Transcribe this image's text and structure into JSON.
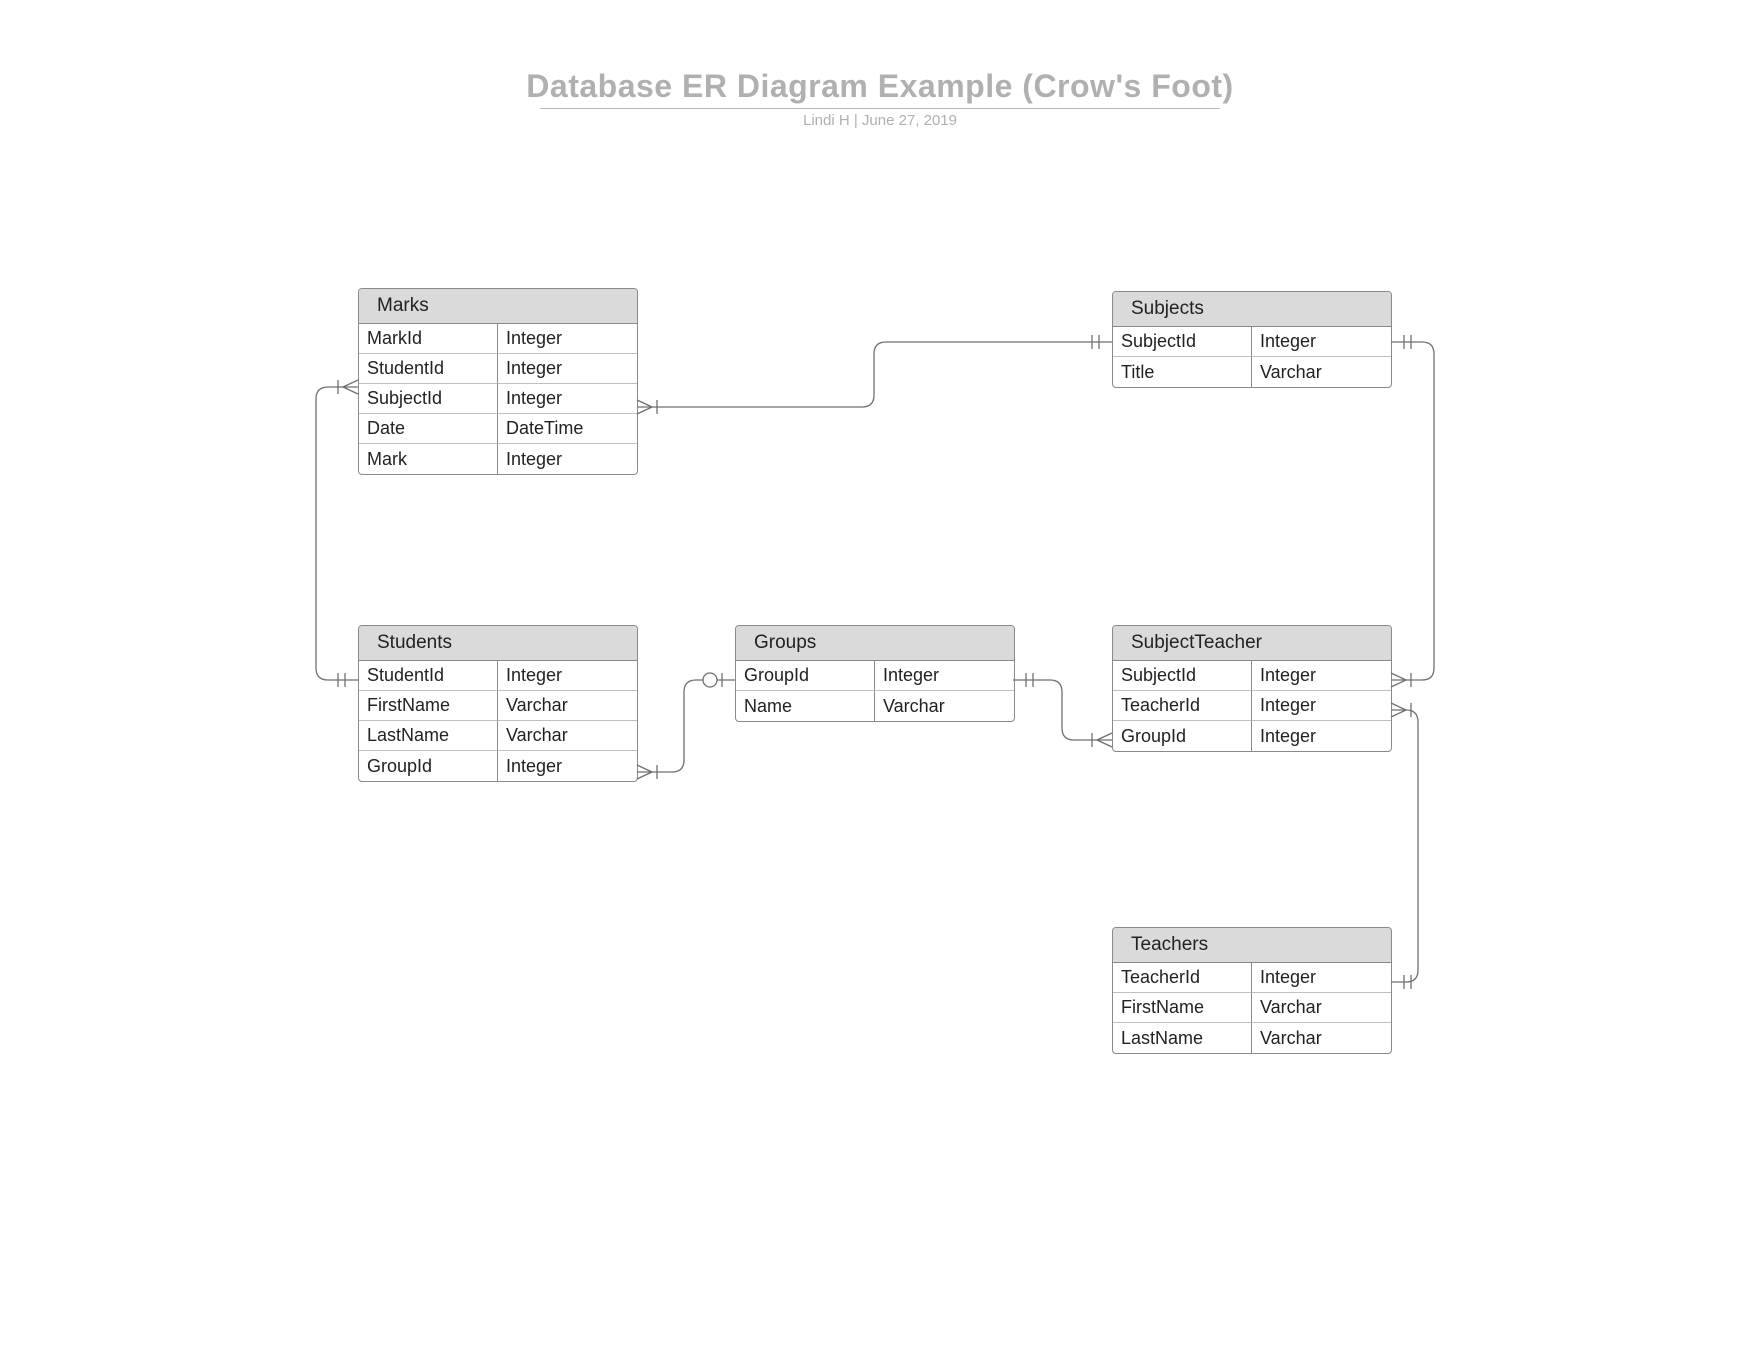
{
  "title": "Database ER Diagram Example (Crow's Foot)",
  "subtitle": "Lindi H  |  June 27, 2019",
  "entities": {
    "marks": {
      "name": "Marks",
      "fields": [
        {
          "name": "MarkId",
          "type": "Integer"
        },
        {
          "name": "StudentId",
          "type": "Integer"
        },
        {
          "name": "SubjectId",
          "type": "Integer"
        },
        {
          "name": "Date",
          "type": "DateTime"
        },
        {
          "name": "Mark",
          "type": "Integer"
        }
      ]
    },
    "subjects": {
      "name": "Subjects",
      "fields": [
        {
          "name": "SubjectId",
          "type": "Integer"
        },
        {
          "name": "Title",
          "type": "Varchar"
        }
      ]
    },
    "students": {
      "name": "Students",
      "fields": [
        {
          "name": "StudentId",
          "type": "Integer"
        },
        {
          "name": "FirstName",
          "type": "Varchar"
        },
        {
          "name": "LastName",
          "type": "Varchar"
        },
        {
          "name": "GroupId",
          "type": "Integer"
        }
      ]
    },
    "groups": {
      "name": "Groups",
      "fields": [
        {
          "name": "GroupId",
          "type": "Integer"
        },
        {
          "name": "Name",
          "type": "Varchar"
        }
      ]
    },
    "subjectteacher": {
      "name": "SubjectTeacher",
      "fields": [
        {
          "name": "SubjectId",
          "type": "Integer"
        },
        {
          "name": "TeacherId",
          "type": "Integer"
        },
        {
          "name": "GroupId",
          "type": "Integer"
        }
      ]
    },
    "teachers": {
      "name": "Teachers",
      "fields": [
        {
          "name": "TeacherId",
          "type": "Integer"
        },
        {
          "name": "FirstName",
          "type": "Varchar"
        },
        {
          "name": "LastName",
          "type": "Varchar"
        }
      ]
    }
  },
  "relationships": [
    {
      "from": "Marks",
      "to": "Students",
      "fromCard": "many",
      "toCard": "one"
    },
    {
      "from": "Marks",
      "to": "Subjects",
      "fromCard": "many",
      "toCard": "one"
    },
    {
      "from": "Students",
      "to": "Groups",
      "fromCard": "many",
      "toCard": "zero-or-one"
    },
    {
      "from": "Groups",
      "to": "SubjectTeacher",
      "fromCard": "one",
      "toCard": "many"
    },
    {
      "from": "Subjects",
      "to": "SubjectTeacher",
      "fromCard": "one",
      "toCard": "many"
    },
    {
      "from": "SubjectTeacher",
      "to": "Teachers",
      "fromCard": "many",
      "toCard": "one"
    }
  ]
}
